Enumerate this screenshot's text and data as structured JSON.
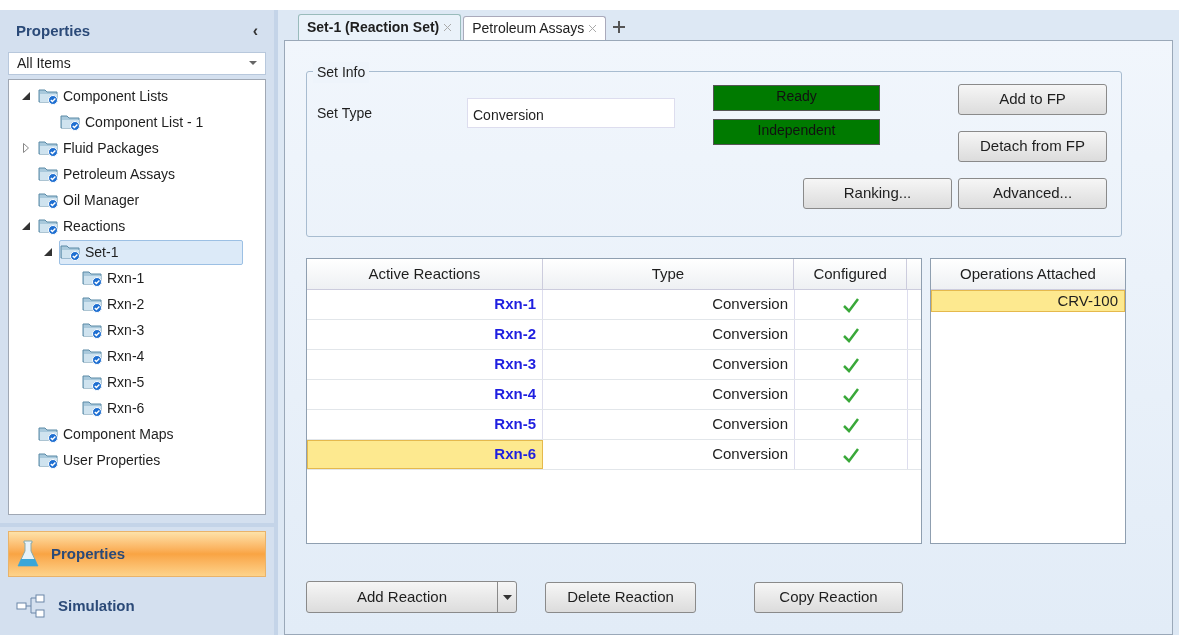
{
  "sidebar": {
    "title": "Properties",
    "collapse_glyph": "‹",
    "filter": {
      "value": "All Items"
    },
    "tree": [
      {
        "label": "Component Lists",
        "expanded": true,
        "selected": false,
        "children": [
          {
            "label": "Component List - 1",
            "selected": false
          }
        ]
      },
      {
        "label": "Fluid Packages",
        "expanded": false,
        "selected": false
      },
      {
        "label": "Petroleum Assays",
        "selected": false
      },
      {
        "label": "Oil Manager",
        "selected": false
      },
      {
        "label": "Reactions",
        "expanded": true,
        "selected": false,
        "children": [
          {
            "label": "Set-1",
            "expanded": true,
            "selected": true,
            "children": [
              {
                "label": "Rxn-1",
                "selected": false
              },
              {
                "label": "Rxn-2",
                "selected": false
              },
              {
                "label": "Rxn-3",
                "selected": false
              },
              {
                "label": "Rxn-4",
                "selected": false
              },
              {
                "label": "Rxn-5",
                "selected": false
              },
              {
                "label": "Rxn-6",
                "selected": false
              }
            ]
          }
        ]
      },
      {
        "label": "Component Maps",
        "selected": false
      },
      {
        "label": "User Properties",
        "selected": false
      }
    ],
    "nav": [
      {
        "label": "Properties",
        "kind": "flask",
        "selected": true
      },
      {
        "label": "Simulation",
        "kind": "diagram",
        "selected": false
      }
    ]
  },
  "tabs": [
    {
      "label": "Set-1 (Reaction Set)",
      "selected": true
    },
    {
      "label": "Petroleum Assays",
      "selected": false
    }
  ],
  "set_info": {
    "title": "Set Info",
    "set_type_label": "Set Type",
    "set_type": "Conversion",
    "status": [
      {
        "label": "Ready",
        "color": "#007a00"
      },
      {
        "label": "Independent",
        "color": "#007a00"
      }
    ],
    "buttons": [
      "Add to FP",
      "Detach from FP",
      "Ranking...",
      "Advanced..."
    ]
  },
  "reactions": {
    "columns": [
      "Active Reactions",
      "Type",
      "Configured"
    ],
    "rows": [
      {
        "name": "Rxn-1",
        "type": "Conversion",
        "configured": true,
        "selected": false
      },
      {
        "name": "Rxn-2",
        "type": "Conversion",
        "configured": true,
        "selected": false
      },
      {
        "name": "Rxn-3",
        "type": "Conversion",
        "configured": true,
        "selected": false
      },
      {
        "name": "Rxn-4",
        "type": "Conversion",
        "configured": true,
        "selected": false
      },
      {
        "name": "Rxn-5",
        "type": "Conversion",
        "configured": true,
        "selected": false
      },
      {
        "name": "Rxn-6",
        "type": "Conversion",
        "configured": true,
        "selected": true
      }
    ]
  },
  "operations": {
    "column": "Operations Attached",
    "rows": [
      {
        "name": "CRV-100",
        "selected": true
      }
    ]
  },
  "bottom_buttons": [
    "Add Reaction",
    "Delete Reaction",
    "Copy Reaction"
  ]
}
